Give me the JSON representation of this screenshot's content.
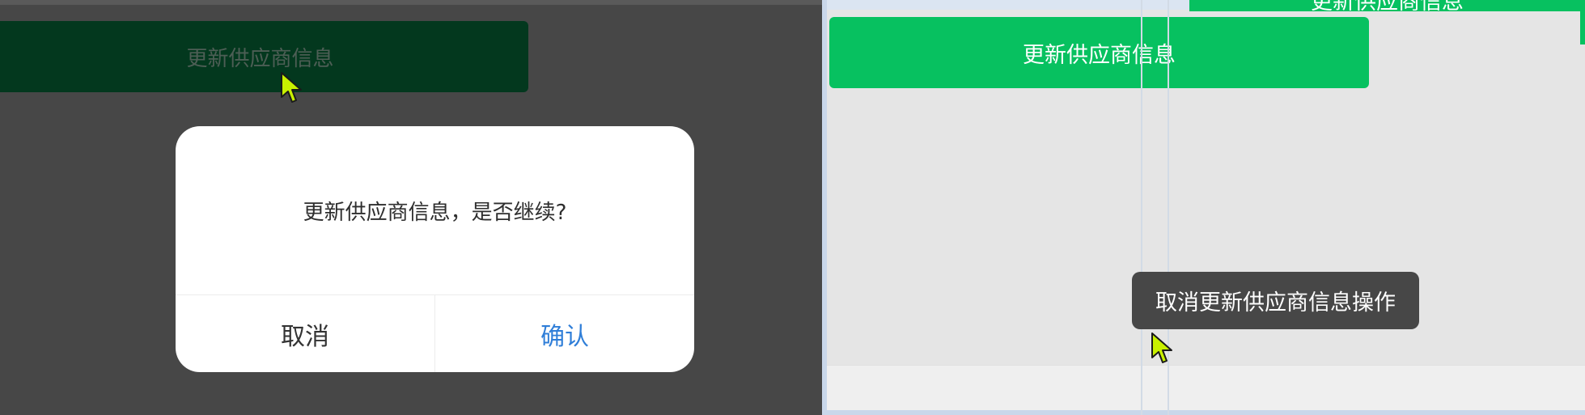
{
  "left_panel": {
    "primary_button_label": "更新供应商信息",
    "dialog": {
      "message": "更新供应商信息，是否继续?",
      "cancel_label": "取消",
      "confirm_label": "确认",
      "confirm_color": "#2f7ed8"
    }
  },
  "right_panel": {
    "primary_button_label": "更新供应商信息",
    "primary_color": "#07c160",
    "toast_message": "取消更新供应商信息操作"
  },
  "peek_window": {
    "button_label": "更新供应商信息"
  },
  "cursors": [
    {
      "name": "mouse-pointer-icon",
      "color": "#c8f000"
    },
    {
      "name": "mouse-pointer-icon",
      "color": "#c8f000"
    }
  ]
}
